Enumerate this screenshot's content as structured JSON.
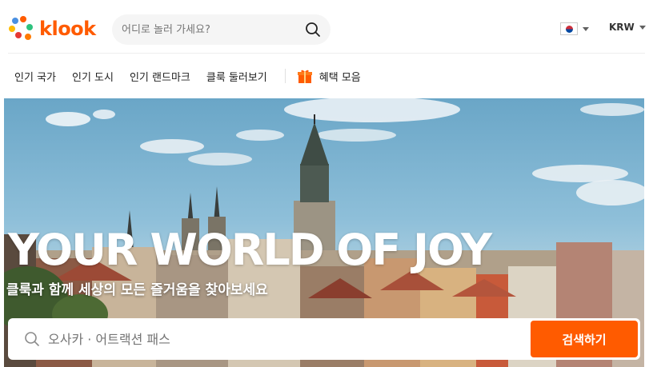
{
  "header": {
    "logo_text": "klook",
    "search_placeholder": "어디로 놀러 가세요?",
    "language_flag_icon": "korea-flag-icon",
    "currency_label": "KRW"
  },
  "nav": {
    "items": [
      {
        "label": "인기 국가"
      },
      {
        "label": "인기 도시"
      },
      {
        "label": "인기 랜드마크"
      },
      {
        "label": "클룩 둘러보기"
      }
    ],
    "benefits_label": "혜택 모음",
    "benefits_icon": "gift-icon"
  },
  "hero": {
    "title": "YOUR WORLD OF JOY",
    "subtitle": "클룩과 함께 세상의 모든 즐거움을 찾아보세요",
    "search_placeholder": "오사카 · 어트랙션 패스",
    "search_button_label": "검색하기"
  },
  "colors": {
    "brand_orange": "#ff5b00"
  }
}
